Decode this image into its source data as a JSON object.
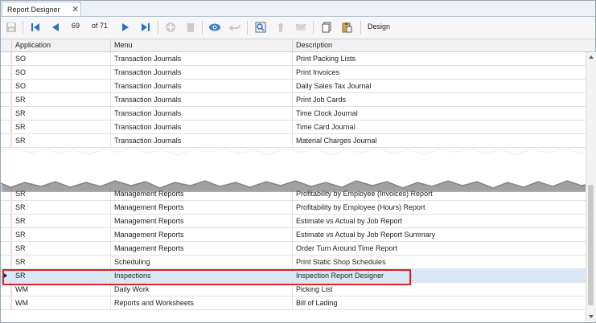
{
  "tab": {
    "title": "Report Designer",
    "close": "✕"
  },
  "toolbar": {
    "position_value": "69",
    "position_of": "of 71",
    "design_label": "Design"
  },
  "grid": {
    "columns": [
      "Application",
      "Menu",
      "Description"
    ],
    "rows_top": [
      [
        "SO",
        "Transaction Journals",
        "Print Packing Lists"
      ],
      [
        "SO",
        "Transaction Journals",
        "Print Invoices"
      ],
      [
        "SO",
        "Transaction Journals",
        "Daily Sales Tax Journal"
      ],
      [
        "SR",
        "Transaction Journals",
        "Print Job Cards"
      ],
      [
        "SR",
        "Transaction Journals",
        "Time Clock Journal"
      ],
      [
        "SR",
        "Transaction Journals",
        "Time Card Journal"
      ],
      [
        "SR",
        "Transaction Journals",
        "Material Charges Journal"
      ]
    ],
    "rows_bottom": [
      [
        "SR",
        "Management Reports",
        "Profitability by Employee (Invoices) Report"
      ],
      [
        "SR",
        "Management Reports",
        "Profitability by Employee (Hours) Report"
      ],
      [
        "SR",
        "Management Reports",
        "Estimate vs Actual by Job Report"
      ],
      [
        "SR",
        "Management Reports",
        "Estimate vs Actual by Job Report Summary"
      ],
      [
        "SR",
        "Management Reports",
        "Order Turn Around Time Report"
      ],
      [
        "SR",
        "Scheduling",
        "Print Static Shop Schedules"
      ],
      [
        "SR",
        "Inspections",
        "Inspection Report Designer"
      ],
      [
        "WM",
        "Daily Work",
        "Picking List"
      ],
      [
        "WM",
        "Reports and Worksheets",
        "Bill of Lading"
      ]
    ],
    "selected_bottom_index": 6
  },
  "colors": {
    "highlight": "#e01e27",
    "selected_row": "#d9e8f8",
    "nav_blue": "#2f6fbf"
  }
}
